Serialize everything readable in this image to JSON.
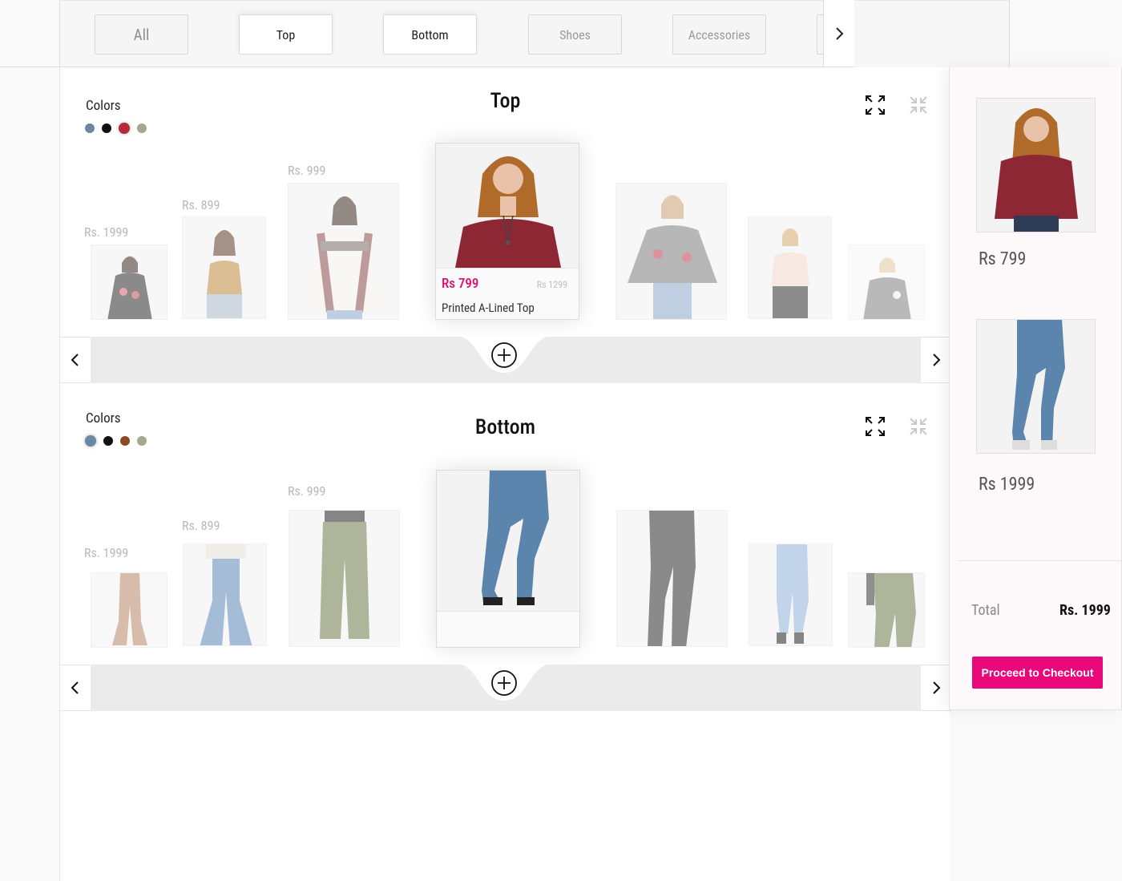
{
  "tabs": [
    {
      "label": "All",
      "state": "default"
    },
    {
      "label": "Top",
      "state": "active"
    },
    {
      "label": "Bottom",
      "state": "active"
    },
    {
      "label": "Shoes",
      "state": "default"
    },
    {
      "label": "Accessories",
      "state": "default"
    }
  ],
  "sections": {
    "top": {
      "title": "Top",
      "colors_label": "Colors",
      "colors": [
        "#6a87a6",
        "#111111",
        "#b5283d",
        "#a3a88e"
      ],
      "selected_color": 2,
      "prices": {
        "p1": "Rs. 1999",
        "p2": "Rs. 899",
        "p3": "Rs. 999"
      },
      "featured": {
        "price": "Rs 799",
        "old_price": "Rs 1299",
        "name": "Printed A-Lined Top"
      }
    },
    "bottom": {
      "title": "Bottom",
      "colors_label": "Colors",
      "colors": [
        "#6a87a6",
        "#111111",
        "#8b4a22",
        "#a3a88e"
      ],
      "selected_color": 0,
      "prices": {
        "p1": "Rs. 1999",
        "p2": "Rs. 899",
        "p3": "Rs. 999"
      }
    }
  },
  "cart": {
    "items": [
      {
        "price": "Rs 799"
      },
      {
        "price": "Rs 1999"
      }
    ],
    "total_label": "Total",
    "total_value": "Rs. 1999",
    "checkout_label": "Proceed to Checkout"
  },
  "theme": {
    "accent": "#e8087a",
    "price_pink": "#e2096e"
  }
}
